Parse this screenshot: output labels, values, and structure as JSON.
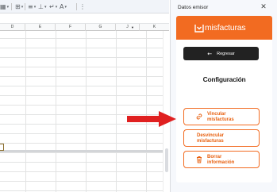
{
  "panel": {
    "title": "Datos emisor",
    "close_icon": "close-icon"
  },
  "addon": {
    "brand_name": "misfacturas",
    "brand_color": "#f26b21",
    "back_button_label": "Regresar",
    "config_title": "Configuración",
    "actions": [
      {
        "label_line1": "Vincular",
        "label_line2": "misfacturas",
        "icon": "link-icon"
      },
      {
        "label_line1": "Desvincular",
        "label_line2": "misfacturas",
        "icon": ""
      },
      {
        "label_line1": "Borrar",
        "label_line2": "información",
        "icon": "trash-icon"
      }
    ]
  },
  "sheet": {
    "columns": [
      "D",
      "E",
      "F",
      "G",
      "J",
      "K"
    ]
  },
  "annotation": {
    "arrow_color": "#e02020"
  }
}
